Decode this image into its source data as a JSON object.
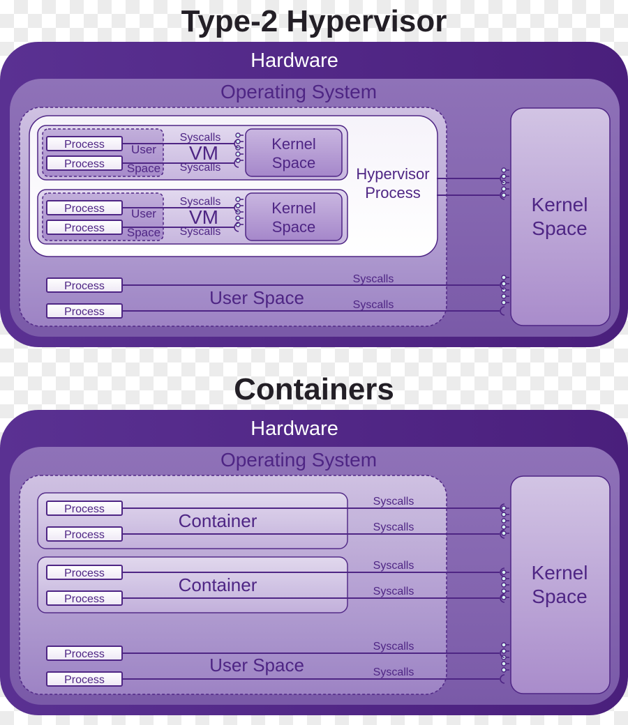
{
  "diagrams": [
    {
      "title": "Type-2 Hypervisor",
      "hardware_label": "Hardware",
      "os_label": "Operating System",
      "kernel_label": [
        "Kernel",
        "Space"
      ],
      "hypervisor_label": [
        "Hypervisor",
        "Process"
      ],
      "vms": [
        {
          "label": "VM",
          "user_space_label": [
            "User",
            "Space"
          ],
          "kernel_label": [
            "Kernel",
            "Space"
          ],
          "processes": [
            "Process",
            "Process"
          ],
          "syscalls": [
            "Syscalls",
            "Syscalls"
          ]
        },
        {
          "label": "VM",
          "user_space_label": [
            "User",
            "Space"
          ],
          "kernel_label": [
            "Kernel",
            "Space"
          ],
          "processes": [
            "Process",
            "Process"
          ],
          "syscalls": [
            "Syscalls",
            "Syscalls"
          ]
        }
      ],
      "user_space_label": "User Space",
      "processes": [
        "Process",
        "Process"
      ],
      "syscalls": [
        "Syscalls",
        "Syscalls"
      ]
    },
    {
      "title": "Containers",
      "hardware_label": "Hardware",
      "os_label": "Operating System",
      "kernel_label": [
        "Kernel",
        "Space"
      ],
      "containers": [
        {
          "label": "Container",
          "processes": [
            "Process",
            "Process"
          ],
          "syscalls": [
            "Syscalls",
            "Syscalls"
          ]
        },
        {
          "label": "Container",
          "processes": [
            "Process",
            "Process"
          ],
          "syscalls": [
            "Syscalls",
            "Syscalls"
          ]
        }
      ],
      "user_space_label": "User Space",
      "processes": [
        "Process",
        "Process"
      ],
      "syscalls": [
        "Syscalls",
        "Syscalls"
      ]
    }
  ],
  "colors": {
    "hardware": "#4f2581",
    "os": "#8f72b8",
    "kernel": "#c9b8de",
    "line": "#4e2584",
    "connector": "#d7f4f2",
    "title": "#231f26"
  }
}
